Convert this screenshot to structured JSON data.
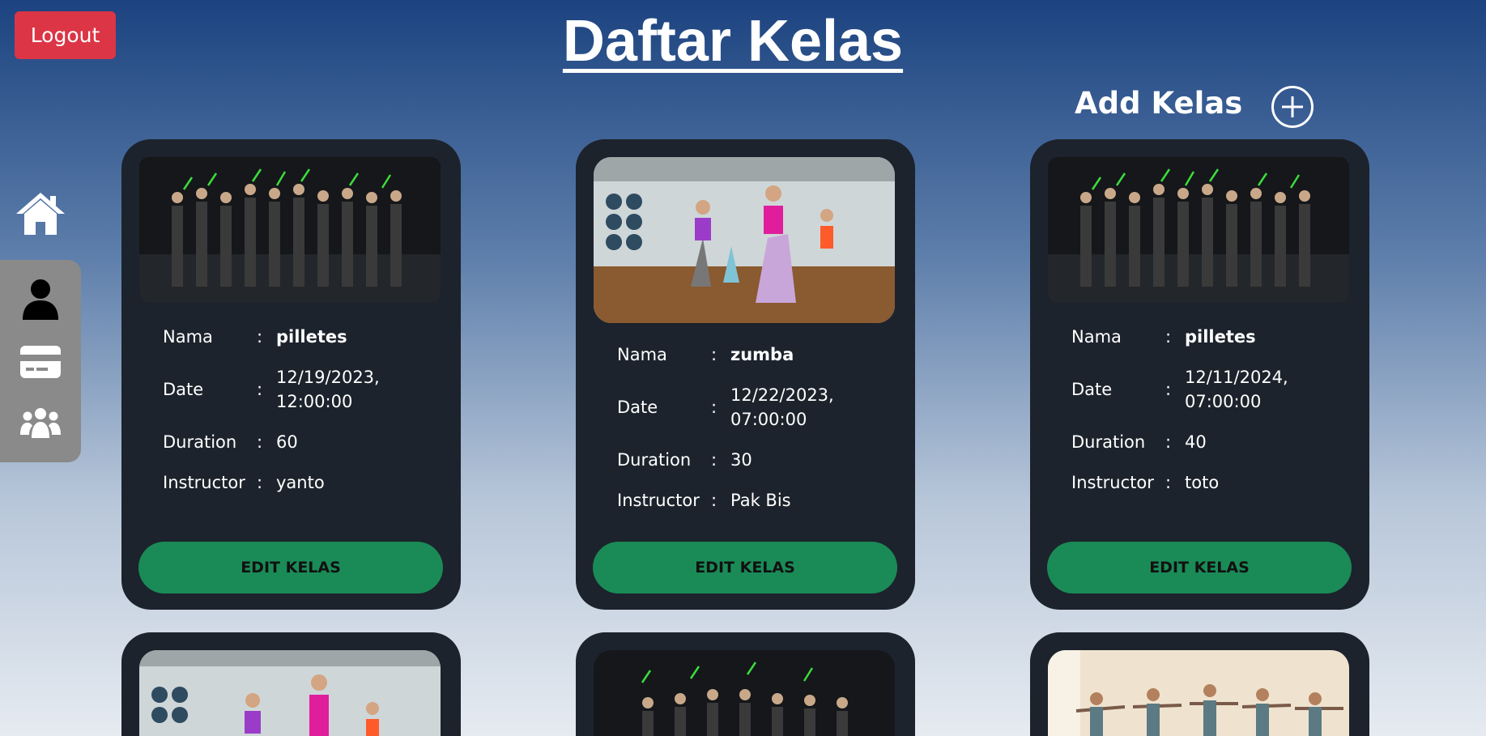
{
  "header": {
    "logout_label": "Logout",
    "title": "Daftar Kelas",
    "add_kelas_label": "Add Kelas"
  },
  "sidebar": {
    "icons": [
      "home-icon",
      "user-icon",
      "credit-card-icon",
      "users-group-icon"
    ]
  },
  "labels": {
    "nama": "Nama",
    "date": "Date",
    "duration": "Duration",
    "instructor": "Instructor",
    "colon": ":"
  },
  "cards": [
    {
      "nama": "pilletes",
      "date": "12/19/2023, 12:00:00",
      "duration": "60",
      "instructor": "yanto",
      "button": "EDIT KELAS"
    },
    {
      "nama": "zumba",
      "date": "12/22/2023, 07:00:00",
      "duration": "30",
      "instructor": "Pak Bis",
      "button": "EDIT KELAS"
    },
    {
      "nama": "pilletes",
      "date": "12/11/2024, 07:00:00",
      "duration": "40",
      "instructor": "toto",
      "button": "EDIT KELAS"
    }
  ],
  "colors": {
    "logout": "#dc3545",
    "card_bg": "#1c232c",
    "edit_button": "#1a8b57"
  }
}
